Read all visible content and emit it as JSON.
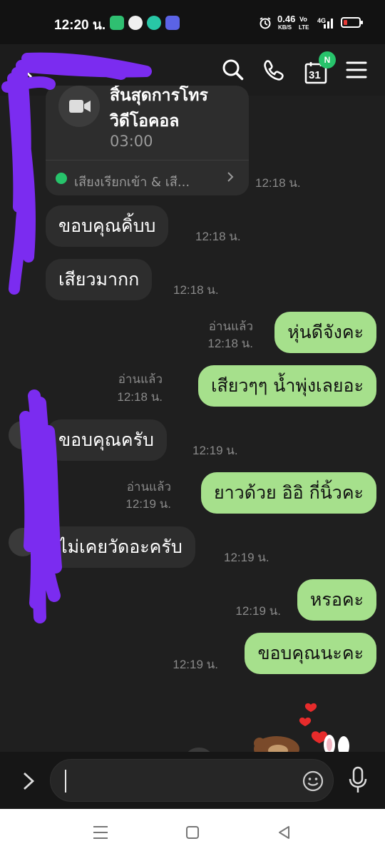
{
  "status_bar": {
    "time": "12:20 น.",
    "speed_value": "0.46",
    "speed_unit": "KB/S",
    "volte_top": "Vo",
    "volte_bottom": "LTE",
    "network": "4G"
  },
  "header": {
    "calendar_day": "31",
    "calendar_badge": "N"
  },
  "call_card": {
    "title_partial": "สิ้นสุดการโทร",
    "subtitle": "วิดีโอคอล",
    "duration": "03:00",
    "footer": "เสียงเรียกเข้า & เสี...",
    "time": "12:18 น."
  },
  "messages": [
    {
      "side": "in",
      "text": "ขอบคุณคิ้บบ",
      "time": "12:18 น."
    },
    {
      "side": "in",
      "text": "เสียวมากก",
      "time": "12:18 น."
    },
    {
      "side": "out",
      "text": "หุ่นดีจังคะ",
      "read": "อ่านแล้ว",
      "time": "12:18 น."
    },
    {
      "side": "out",
      "text": "เสียวๆๆ น้ำพุ่งเลยอะ",
      "read": "อ่านแล้ว",
      "time": "12:18 น."
    },
    {
      "side": "in",
      "text": "ขอบคุณครับ",
      "time": "12:19 น."
    },
    {
      "side": "out",
      "text": "ยาวด้วย อิอิ กี่นิ้วคะ",
      "read": "อ่านแล้ว",
      "time": "12:19 น."
    },
    {
      "side": "in",
      "text": "ไม่เคยวัดอะครับ",
      "time": "12:19 น."
    },
    {
      "side": "out",
      "text": "หรอคะ",
      "time": "12:19 น."
    },
    {
      "side": "out",
      "text": "ขอบคุณนะคะ",
      "time": "12:19 น."
    }
  ],
  "input": {
    "value": ""
  },
  "colors": {
    "outgoing_bubble": "#a6e08c",
    "incoming_bubble": "#2d2d2d",
    "background": "#1f1f1f",
    "scribble": "#7b2cf0",
    "badge": "#27c36b"
  }
}
